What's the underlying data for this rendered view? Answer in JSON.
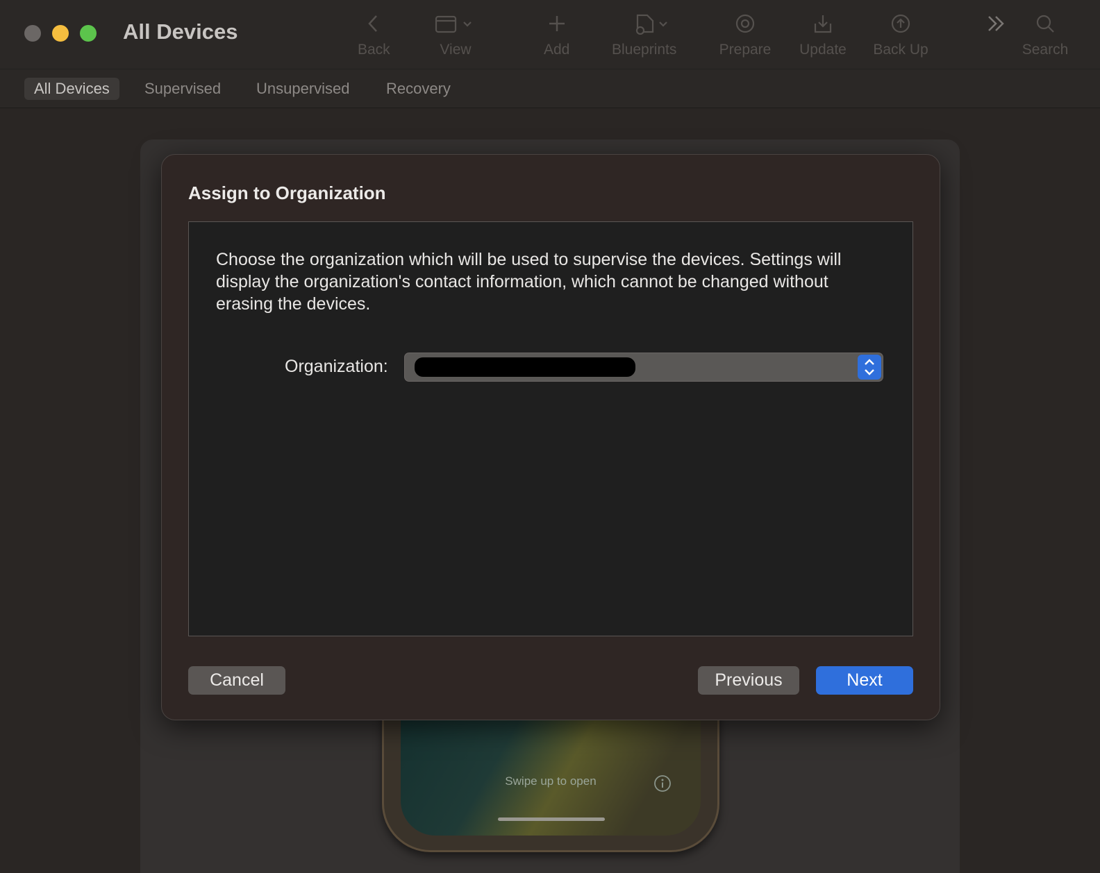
{
  "window": {
    "title": "All Devices"
  },
  "toolbar": {
    "back": "Back",
    "view": "View",
    "add": "Add",
    "blueprints": "Blueprints",
    "prepare": "Prepare",
    "update": "Update",
    "backup": "Back Up",
    "search": "Search"
  },
  "tabs": [
    {
      "label": "All Devices"
    },
    {
      "label": "Supervised"
    },
    {
      "label": "Unsupervised"
    },
    {
      "label": "Recovery"
    }
  ],
  "dialog": {
    "title": "Assign to Organization",
    "description": "Choose the organization which will be used to supervise the devices. Settings will display the organization's contact information, which cannot be changed without erasing the devices.",
    "organization_label": "Organization:",
    "cancel": "Cancel",
    "previous": "Previous",
    "next": "Next"
  },
  "device": {
    "lock_hint": "Swipe up to open"
  },
  "colors": {
    "accent": "#2f6fdc",
    "close": "#6b6765",
    "minimize": "#f5be3f",
    "maximize": "#5cc44c"
  }
}
